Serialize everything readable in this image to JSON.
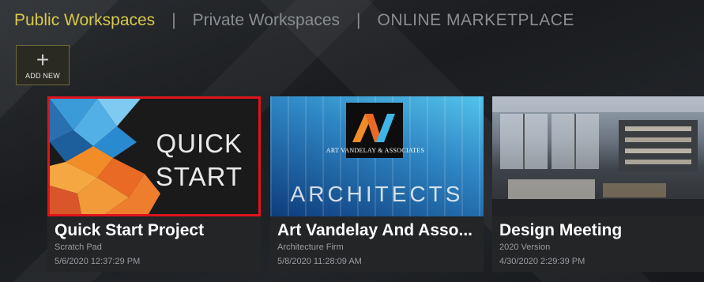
{
  "nav": {
    "tabs": [
      {
        "label": "Public Workspaces",
        "active": true
      },
      {
        "label": "Private Workspaces",
        "active": false
      },
      {
        "label": "ONLINE MARKETPLACE",
        "active": false
      }
    ],
    "separator": "|"
  },
  "add_new": {
    "icon": "plus-icon",
    "symbol": "+",
    "label": "ADD NEW"
  },
  "colors": {
    "active_tab": "#d8c94a",
    "inactive_tab": "#8a8d91",
    "selected_border": "#e0141c"
  },
  "cards": [
    {
      "title": "Quick Start Project",
      "subtitle": "Scratch Pad",
      "date": "5/6/2020 12:37:29 PM",
      "thumb_text_1": "QUICK",
      "thumb_text_2": "START",
      "selected": true
    },
    {
      "title": "Art Vandelay And Asso...",
      "subtitle": "Architecture Firm",
      "date": "5/8/2020 11:28:09 AM",
      "thumb_small": "ART VANDELAY & ASSOCIATES",
      "thumb_big": "ARCHITECTS",
      "selected": false
    },
    {
      "title": "Design Meeting",
      "subtitle": "2020 Version",
      "date": "4/30/2020 2:29:39 PM",
      "selected": false
    }
  ]
}
